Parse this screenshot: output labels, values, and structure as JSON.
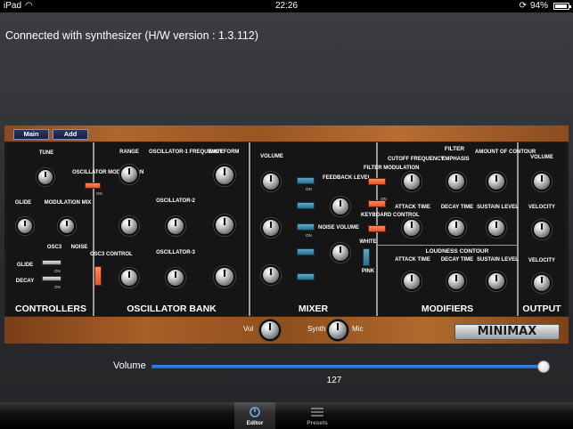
{
  "status": {
    "device": "iPad",
    "time": "22:26",
    "battery": "94%"
  },
  "connection": "Connected with synthesizer (H/W version : 1.3.112)",
  "top_buttons": [
    "Main",
    "Add"
  ],
  "sections": {
    "controllers": "CONTROLLERS",
    "oscillator_bank": "OSCILLATOR BANK",
    "mixer": "MIXER",
    "modifiers": "MODIFIERS",
    "output": "OUTPUT"
  },
  "controllers": {
    "tune": "TUNE",
    "glide": "GLIDE",
    "modulation_mix": "MODULATION MIX",
    "osc3": "OSC3",
    "noise": "NOISE",
    "decay": "DECAY",
    "on": "ON"
  },
  "oscillator_bank": {
    "osc_modulation": "OSCILLATOR MODULATION",
    "on": "ON",
    "range": "RANGE",
    "osc1_frequency": "OSCILLATOR-1 FREQUENCY",
    "waveform": "WAVEFORM",
    "osc2": "OSCILLATOR-2",
    "osc3": "OSCILLATOR-3",
    "osc3_control": "OSC3 CONTROL"
  },
  "mixer": {
    "volume": "VOLUME",
    "on": "ON",
    "feedback_level": "FEEDBACK LEVEL",
    "noise_volume": "NOISE VOLUME",
    "white": "WHITE",
    "pink": "PINK"
  },
  "modifiers": {
    "filter_modulation": "FILTER MODULATION",
    "on": "ON",
    "keyboard_control": "KEYBOARD CONTROL",
    "filter": "FILTER",
    "cutoff_frequency": "CUTOFF FREQUENCY",
    "emphasis": "EMPHASIS",
    "amount_of_contour": "AMOUNT OF CONTOUR",
    "attack_time": "ATTACK TIME",
    "decay_time": "DECAY TIME",
    "sustain_level": "SUSTAIN LEVEL",
    "loudness_contour": "LOUDNESS CONTOUR"
  },
  "output": {
    "volume": "VOLUME",
    "velocity": "VELOCITY"
  },
  "bottom": {
    "vol": "Vol",
    "synth": "Synth",
    "mic": "Mic",
    "logo": "MINIMAX"
  },
  "volume": {
    "label": "Volume",
    "value": "127",
    "level_fraction": 1.0
  },
  "tabs": [
    "Editor",
    "Presets"
  ],
  "colors": {
    "accent_blue": "#3c8ff0",
    "switch_orange": "#f06a3a",
    "switch_blue": "#3f8bab",
    "wood": "#a05a26"
  }
}
